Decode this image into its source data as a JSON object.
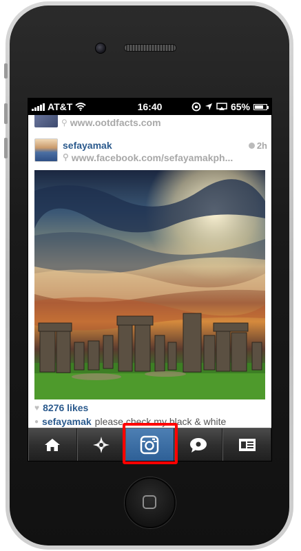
{
  "status_bar": {
    "carrier": "AT&T",
    "time": "16:40",
    "battery": "65%"
  },
  "feed": {
    "previous_post_location": "www.ootdfacts.com",
    "post": {
      "username": "sefayamak",
      "time_ago": "2h",
      "location": "www.facebook.com/sefayamakph...",
      "likes": "8276 likes",
      "caption_user": "sefayamak",
      "caption_text": "please check my black & white"
    }
  },
  "tab_bar": {
    "tabs": [
      {
        "name": "home",
        "icon": "house-icon"
      },
      {
        "name": "explore",
        "icon": "star-icon"
      },
      {
        "name": "camera",
        "icon": "camera-icon",
        "active": true
      },
      {
        "name": "news",
        "icon": "speech-bubble-icon"
      },
      {
        "name": "profile",
        "icon": "profile-card-icon"
      }
    ]
  },
  "colors": {
    "username": "#2b5a8d",
    "active_tab": "#3b6ea5",
    "highlight": "#ff0000"
  }
}
